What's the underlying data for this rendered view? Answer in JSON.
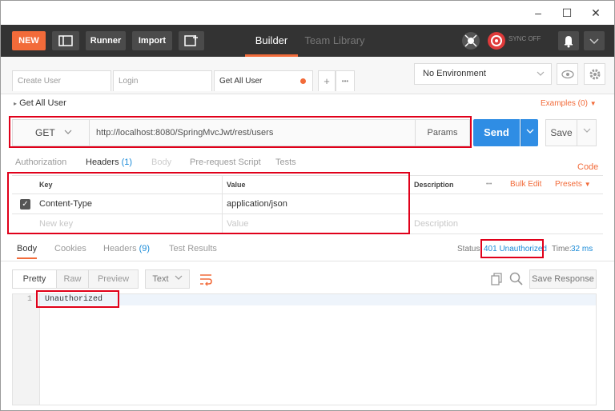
{
  "window": {
    "minimize": "–",
    "maximize": "☐",
    "close": "✕"
  },
  "toolbar": {
    "new_label": "NEW",
    "runner_label": "Runner",
    "import_label": "Import",
    "tab_builder": "Builder",
    "tab_team_library": "Team Library",
    "sync_label": "SYNC OFF"
  },
  "request_tabs": [
    {
      "label": "Create User"
    },
    {
      "label": "Login"
    },
    {
      "label": "Get All User"
    }
  ],
  "tabs_more": "•••",
  "tabs_add": "+",
  "environment": {
    "selected": "No Environment"
  },
  "request": {
    "collection_item": "Get All User",
    "examples": "Examples (0)",
    "method": "GET",
    "url": "http://localhost:8080/SpringMvcJwt/rest/users",
    "params_label": "Params",
    "send_label": "Send",
    "save_label": "Save"
  },
  "request_subtabs": {
    "authorization": "Authorization",
    "headers": "Headers",
    "headers_count": "(1)",
    "body": "Body",
    "pre_request": "Pre-request Script",
    "tests": "Tests",
    "code": "Code"
  },
  "headers_table": {
    "col_key": "Key",
    "col_value": "Value",
    "col_description": "Description",
    "more": "•••",
    "bulk_edit": "Bulk Edit",
    "presets": "Presets",
    "rows": [
      {
        "key": "Content-Type",
        "value": "application/json",
        "checked": true
      }
    ],
    "new_key_placeholder": "New key",
    "value_placeholder": "Value",
    "description_placeholder": "Description"
  },
  "response": {
    "tabs": {
      "body": "Body",
      "cookies": "Cookies",
      "headers": "Headers",
      "headers_count": "(9)",
      "test_results": "Test Results"
    },
    "status_label": "Status:",
    "status_value": "401 Unauthorized",
    "time_label": "Time:",
    "time_value": "32 ms",
    "view_pretty": "Pretty",
    "view_raw": "Raw",
    "view_preview": "Preview",
    "format": "Text",
    "save_response": "Save Response",
    "line_number": "1",
    "body_text": "Unauthorized"
  },
  "colors": {
    "accent": "#f26b3a",
    "send_blue": "#2f8de4",
    "highlight_red": "#e0001a",
    "toolbar_bg": "#333333"
  }
}
